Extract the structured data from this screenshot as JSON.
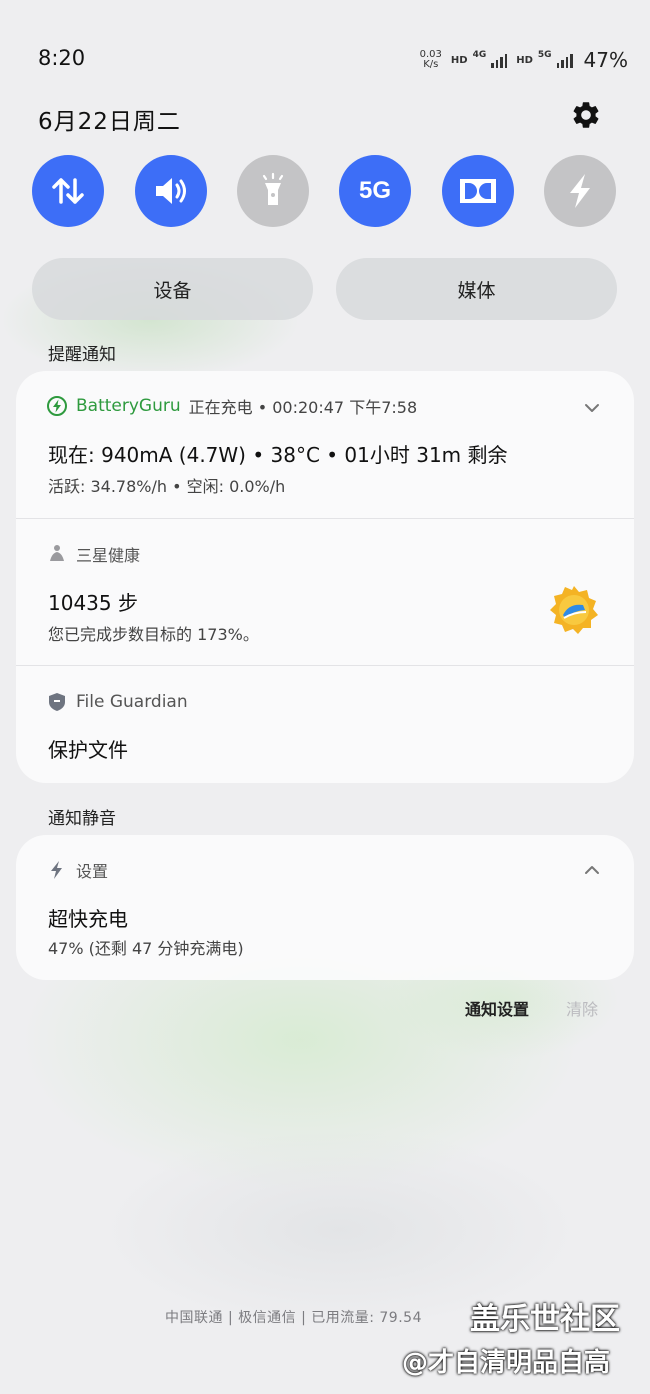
{
  "status_bar": {
    "time": "8:20",
    "net_speed_value": "0.03",
    "net_speed_unit": "K/s",
    "hd1": "HD",
    "net1": "4G",
    "hd2": "HD",
    "net2": "5G",
    "battery": "47%"
  },
  "header": {
    "date": "6月22日周二",
    "settings_icon": "gear-icon"
  },
  "quick_toggles": [
    {
      "icon": "data-transfer-icon",
      "state": "on"
    },
    {
      "icon": "sound-icon",
      "state": "on"
    },
    {
      "icon": "flashlight-icon",
      "state": "off"
    },
    {
      "label": "5G",
      "icon": "5g-icon",
      "state": "on"
    },
    {
      "icon": "dolby-icon",
      "state": "on"
    },
    {
      "icon": "lightning-icon",
      "state": "off"
    }
  ],
  "pills": {
    "devices": "设备",
    "media": "媒体"
  },
  "alerts_section": {
    "title": "提醒通知",
    "notifications": [
      {
        "app": "BatteryGuru",
        "meta": "正在充电 • 00:20:47  下午7:58",
        "title": "现在: 940mA (4.7W) • 38°C • 01小时 31m 剩余",
        "body": "活跃: 34.78%/h • 空闲: 0.0%/h"
      },
      {
        "app": "三星健康",
        "title": "10435 步",
        "body": "您已完成步数目标的 173%。"
      },
      {
        "app": "File Guardian",
        "title": "保护文件"
      }
    ]
  },
  "silent_section": {
    "title": "通知静音",
    "notifications": [
      {
        "app": "设置",
        "title": "超快充电",
        "body": "47% (还剩 47 分钟充满电)"
      }
    ]
  },
  "actions": {
    "settings": "通知设置",
    "clear": "清除"
  },
  "footer": {
    "carrier": "中国联通 | 极信通信 | 已用流量: 79.54",
    "watermark_line1": "盖乐世社区",
    "watermark_line2": "@才自清明品自高"
  },
  "colors": {
    "accent": "#3d6ef7",
    "toggle_off": "#c4c4c6",
    "battery_green": "#2e9a3e"
  }
}
